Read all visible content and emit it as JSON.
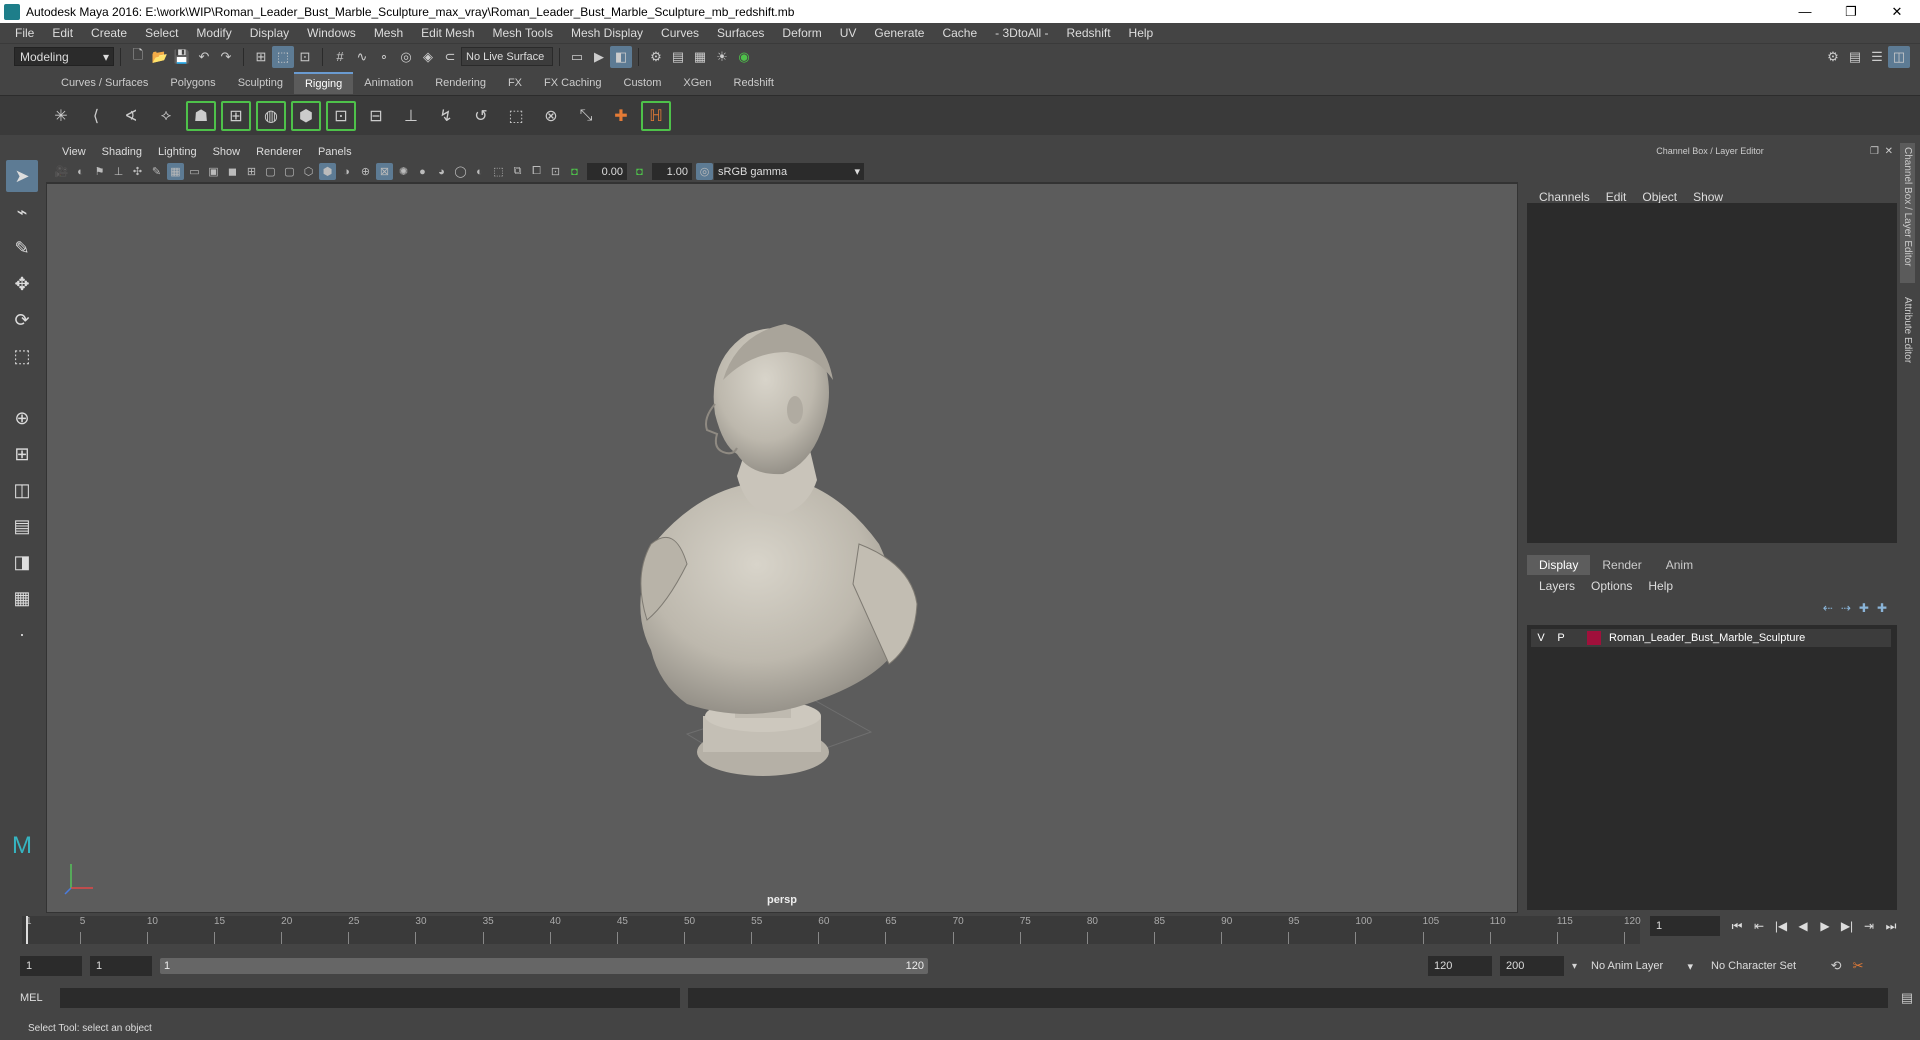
{
  "window": {
    "title": "Autodesk Maya 2016: E:\\work\\WIP\\Roman_Leader_Bust_Marble_Sculpture_max_vray\\Roman_Leader_Bust_Marble_Sculpture_mb_redshift.mb",
    "minimize": "—",
    "restore": "❐",
    "close": "✕"
  },
  "menubar": [
    "File",
    "Edit",
    "Create",
    "Select",
    "Modify",
    "Display",
    "Windows",
    "Mesh",
    "Edit Mesh",
    "Mesh Tools",
    "Mesh Display",
    "Curves",
    "Surfaces",
    "Deform",
    "UV",
    "Generate",
    "Cache",
    "- 3DtoAll -",
    "Redshift",
    "Help"
  ],
  "statusline": {
    "mode": "Modeling",
    "live_surface": "No Live Surface"
  },
  "shelf_tabs": [
    "Curves / Surfaces",
    "Polygons",
    "Sculpting",
    "Rigging",
    "Animation",
    "Rendering",
    "FX",
    "FX Caching",
    "Custom",
    "XGen",
    "Redshift"
  ],
  "shelf_active": "Rigging",
  "viewport": {
    "menu": [
      "View",
      "Shading",
      "Lighting",
      "Show",
      "Renderer",
      "Panels"
    ],
    "exposure": "0.00",
    "gamma_value": "1.00",
    "color_space": "sRGB gamma",
    "camera": "persp"
  },
  "channel_box": {
    "header": "Channel Box / Layer Editor",
    "menu": [
      "Channels",
      "Edit",
      "Object",
      "Show"
    ]
  },
  "layer_editor": {
    "tabs": [
      "Display",
      "Render",
      "Anim"
    ],
    "menu": [
      "Layers",
      "Options",
      "Help"
    ],
    "layers": [
      {
        "v": "V",
        "p": "P",
        "name": "Roman_Leader_Bust_Marble_Sculpture",
        "color": "#a0103b"
      }
    ]
  },
  "side_tabs": [
    "Channel Box / Layer Editor",
    "Attribute Editor"
  ],
  "timeline": {
    "ticks": [
      "1",
      "5",
      "10",
      "15",
      "20",
      "25",
      "30",
      "35",
      "40",
      "45",
      "50",
      "55",
      "60",
      "65",
      "70",
      "75",
      "80",
      "85",
      "90",
      "95",
      "100",
      "105",
      "110",
      "115",
      "120"
    ],
    "current_frame": "1"
  },
  "range": {
    "start": "1",
    "playback_start": "1",
    "slider_start": "1",
    "slider_end": "120",
    "playback_end": "120",
    "end": "200",
    "anim_layer": "No Anim Layer",
    "character_set": "No Character Set"
  },
  "mel": {
    "label": "MEL"
  },
  "help_line": "Select Tool: select an object",
  "colors": {
    "accent": "#5d7b94",
    "shelf_green": "#4ec14a",
    "viewport_bg": "#5c5c5c"
  }
}
